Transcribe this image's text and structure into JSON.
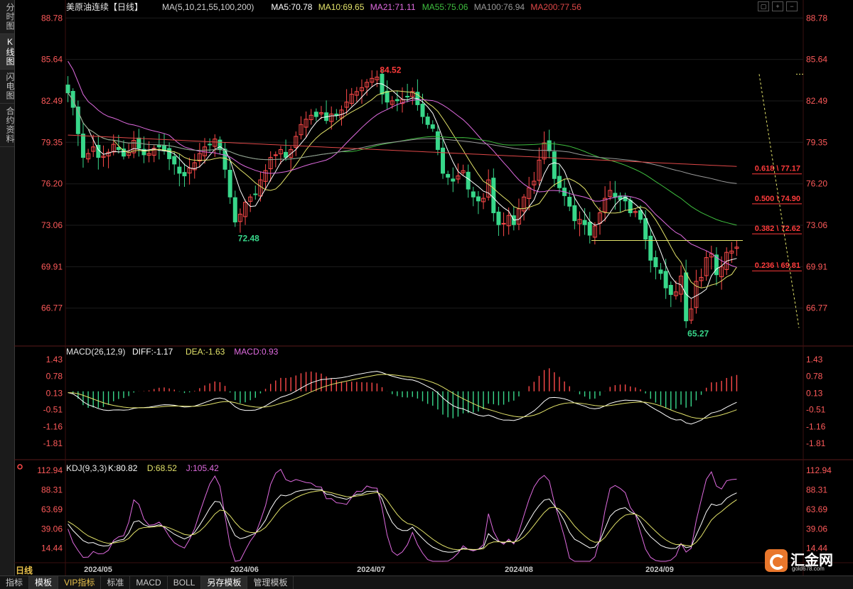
{
  "sidebar": {
    "tabs": [
      "分时图",
      "K线图",
      "闪电图",
      "合约资料"
    ],
    "active_index": 1
  },
  "toolbar_icons": [
    "fit-icon",
    "zoom-in-icon",
    "zoom-out-icon"
  ],
  "period_label": "日线",
  "bottom_tabs": [
    "指标",
    "模板",
    "VIP指标",
    "标准",
    "MACD",
    "BOLL",
    "另存模板",
    "管理模板"
  ],
  "logo": {
    "text": "汇金网",
    "url": "gold678.com"
  },
  "colors": {
    "up": "#ff4a4a",
    "down": "#38d78a",
    "ma5": "#ffffff",
    "ma10": "#e3e36a",
    "ma21": "#e06be0",
    "ma55": "#3fbf3f",
    "ma100": "#9a9a9a",
    "ma200": "#e04848",
    "fib": "#ff3b3b",
    "axis_text": "#ff5a5a"
  },
  "chart_data": [
    {
      "type": "candlestick",
      "title": "美原油连续【日线】",
      "legend": [
        {
          "label": "MA(5,10,21,55,100,200)",
          "color": "#d0d0d0"
        },
        {
          "label": "MA5:70.78",
          "color": "#ffffff"
        },
        {
          "label": "MA10:69.65",
          "color": "#e3e36a"
        },
        {
          "label": "MA21:71.11",
          "color": "#e06be0"
        },
        {
          "label": "MA55:75.06",
          "color": "#3fbf3f"
        },
        {
          "label": "MA100:76.94",
          "color": "#9a9a9a"
        },
        {
          "label": "MA200:77.56",
          "color": "#e04848"
        }
      ],
      "y_ticks": [
        "88.78",
        "85.64",
        "82.49",
        "79.35",
        "76.20",
        "73.06",
        "69.91",
        "66.77"
      ],
      "x_labels": [
        "2024/05",
        "2024/06",
        "2024/07",
        "2024/08",
        "2024/09"
      ],
      "annotations": {
        "high": "84.52",
        "low_june": "72.48",
        "low_sep": "65.27"
      },
      "fib_levels": [
        {
          "label": "0.618 \\ 77.17",
          "value": 77.17
        },
        {
          "label": "0.500 \\ 74.90",
          "value": 74.9
        },
        {
          "label": "0.382 \\ 72.62",
          "value": 72.62
        },
        {
          "label": "0.236 \\ 69.81",
          "value": 69.81
        }
      ],
      "horizontal_line": 71.9,
      "ylim": [
        64.0,
        89.5
      ],
      "close": [
        83.1,
        82.0,
        80.0,
        78.2,
        78.5,
        79.0,
        78.2,
        78.3,
        78.6,
        79.2,
        78.8,
        78.3,
        78.6,
        79.5,
        78.9,
        78.4,
        78.5,
        78.9,
        79.0,
        78.7,
        78.1,
        77.7,
        77.0,
        76.8,
        77.4,
        77.8,
        78.5,
        79.0,
        79.2,
        79.6,
        78.8,
        77.3,
        75.2,
        73.3,
        73.9,
        74.8,
        75.2,
        75.4,
        76.5,
        77.2,
        78.2,
        78.4,
        78.8,
        78.2,
        78.8,
        79.8,
        80.7,
        81.1,
        81.4,
        81.3,
        81.6,
        81.0,
        81.5,
        81.4,
        81.8,
        82.4,
        83.0,
        83.2,
        83.5,
        83.9,
        84.2,
        84.3,
        83.0,
        82.4,
        82.5,
        82.5,
        82.6,
        82.8,
        83.2,
        82.2,
        81.3,
        80.7,
        80.4,
        78.8,
        77.0,
        76.7,
        76.4,
        76.8,
        77.2,
        75.8,
        75.2,
        74.9,
        75.1,
        76.5,
        74.0,
        73.1,
        73.2,
        73.8,
        73.1,
        74.3,
        75.2,
        75.9,
        76.4,
        78.0,
        79.3,
        78.7,
        76.6,
        75.9,
        75.3,
        74.5,
        73.4,
        73.5,
        73.1,
        72.3,
        73.0,
        74.0,
        75.1,
        75.7,
        75.2,
        75.0,
        74.9,
        74.0,
        74.1,
        73.5,
        72.0,
        70.4,
        69.9,
        69.4,
        68.3,
        67.8,
        68.0,
        69.2,
        65.8,
        66.7,
        68.8,
        69.1,
        70.6,
        70.9,
        69.3,
        69.9,
        71.0,
        71.1,
        71.4
      ],
      "indicator_charts": [
        {
          "type": "line+histogram",
          "title": "MACD(26,12,9)",
          "legend": [
            {
              "label": "DIFF:-1.17",
              "color": "#ffffff"
            },
            {
              "label": "DEA:-1.63",
              "color": "#e3e36a"
            },
            {
              "label": "MACD:0.93",
              "color": "#e06be0"
            }
          ],
          "y_ticks": [
            "1.43",
            "0.78",
            "0.13",
            "-0.51",
            "-1.16",
            "-1.81"
          ],
          "ylim": [
            -2.3,
            1.7
          ]
        },
        {
          "type": "line",
          "title": "KDJ(9,3,3)",
          "legend": [
            {
              "label": "K:80.82",
              "color": "#ffffff"
            },
            {
              "label": "D:68.52",
              "color": "#e3e36a"
            },
            {
              "label": "J:105.42",
              "color": "#e06be0"
            }
          ],
          "y_ticks": [
            "112.94",
            "88.31",
            "63.69",
            "39.06",
            "14.44"
          ],
          "ylim": [
            -2,
            122
          ]
        }
      ]
    }
  ]
}
